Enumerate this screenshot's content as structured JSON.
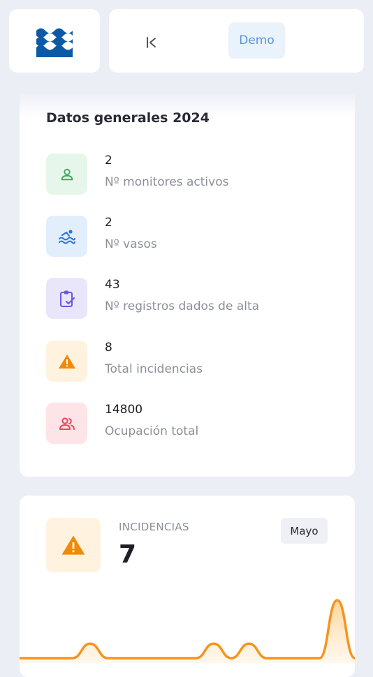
{
  "header": {
    "logo_icon": "water-waves-logo",
    "collapse_icon": "collapse-sidebar-icon",
    "demo_label": "Demo",
    "logo_color": "#0c5aa6"
  },
  "stats": {
    "title": "Datos generales 2024",
    "items": [
      {
        "value": "2",
        "label": "Nº monitores activos",
        "icon": "user-icon",
        "bg": "#e6f6ea",
        "color": "#3fa45a"
      },
      {
        "value": "2",
        "label": "Nº vasos",
        "icon": "swimmer-icon",
        "bg": "#e2eefc",
        "color": "#2f72d6"
      },
      {
        "value": "43",
        "label": "Nº registros dados de alta",
        "icon": "clipboard-check-icon",
        "bg": "#e9e6fc",
        "color": "#6a58e0"
      },
      {
        "value": "8",
        "label": "Total incidencias",
        "icon": "warning-icon",
        "bg": "#fff2df",
        "color": "#f18a07"
      },
      {
        "value": "14800",
        "label": "Ocupación total",
        "icon": "users-icon",
        "bg": "#fde4e6",
        "color": "#e9445a"
      }
    ]
  },
  "incidents": {
    "label": "INCIDENCIAS",
    "value": "7",
    "month": "Mayo",
    "icon": "warning-icon",
    "accent": "#f7931e"
  },
  "chart_data": {
    "type": "area",
    "series": [
      {
        "values": [
          0,
          0,
          0,
          0,
          1,
          0,
          0,
          0,
          0,
          0,
          0,
          1,
          0,
          1,
          0,
          0,
          0,
          0,
          4,
          0
        ]
      }
    ]
  }
}
